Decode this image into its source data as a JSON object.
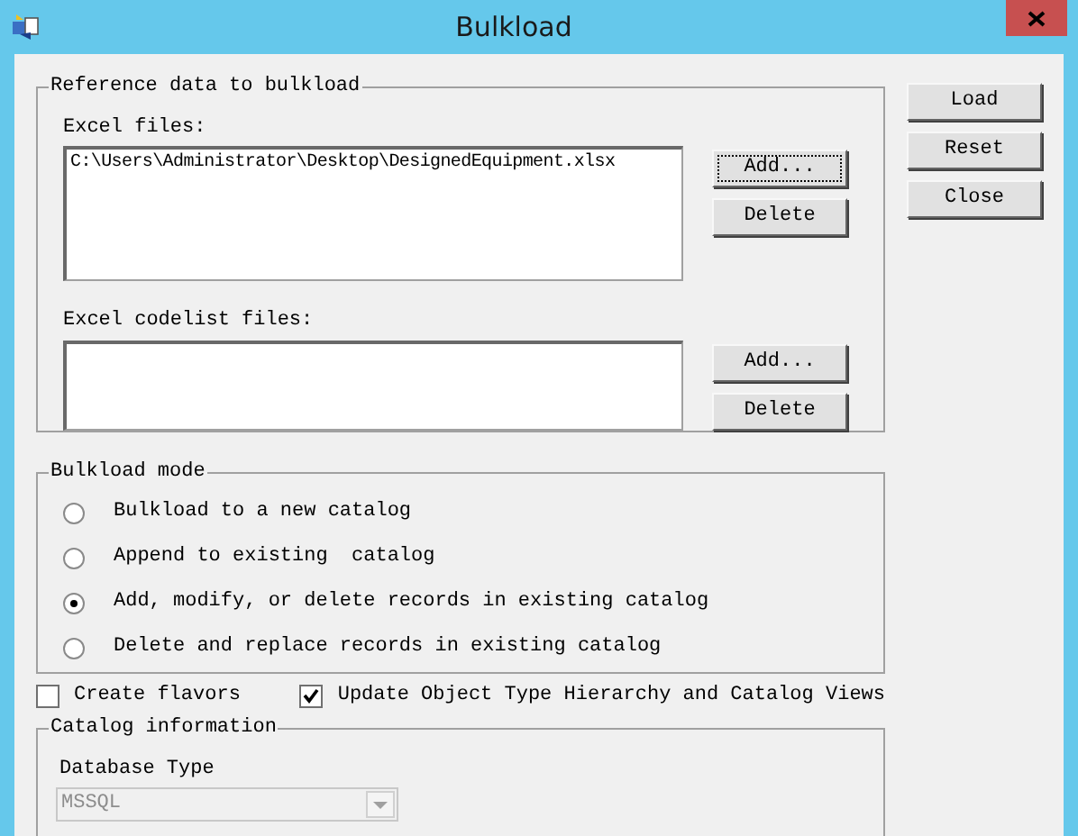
{
  "window": {
    "title": "Bulkload"
  },
  "reference_group": {
    "legend": "Reference data to bulkload",
    "excel_files": {
      "label": "Excel files:",
      "items": [
        "C:\\Users\\Administrator\\Desktop\\DesignedEquipment.xlsx"
      ],
      "buttons": [
        {
          "label": "Add...",
          "focused": true
        },
        {
          "label": "Delete",
          "focused": false
        }
      ]
    },
    "codelist_files": {
      "label": "Excel codelist files:",
      "buttons": [
        {
          "label": "Add...",
          "focused": false
        },
        {
          "label": "Delete",
          "focused": false
        }
      ]
    }
  },
  "side_buttons": [
    "Load",
    "Reset",
    "Close"
  ],
  "mode_group": {
    "legend": "Bulkload mode",
    "options": [
      {
        "label": "Bulkload to a new catalog",
        "selected": false
      },
      {
        "label": "Append to existing  catalog",
        "selected": false
      },
      {
        "label": "Add, modify, or delete records in existing catalog",
        "selected": true
      },
      {
        "label": "Delete and replace records in existing catalog",
        "selected": false
      }
    ]
  },
  "checkboxes": [
    {
      "label": "Create flavors",
      "checked": false
    },
    {
      "label": "Update Object Type Hierarchy and Catalog Views",
      "checked": true
    }
  ],
  "catalog_group": {
    "legend": "Catalog information",
    "database_type": {
      "label": "Database Type",
      "value": "MSSQL",
      "disabled": true
    }
  }
}
